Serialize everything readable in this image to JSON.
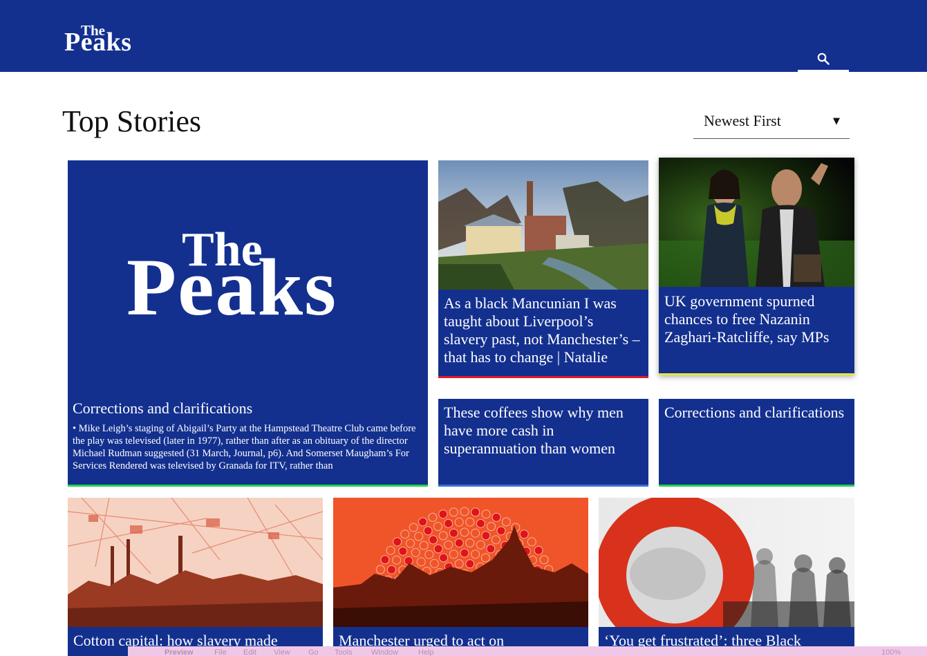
{
  "header": {
    "logo_the": "The",
    "logo_peaks": "Peaks",
    "search_icon": "search-icon",
    "brand_color": "#13308f"
  },
  "main": {
    "title": "Top Stories",
    "sort_label": "Newest First",
    "sort_caret": "▼"
  },
  "cards": {
    "lead": {
      "logo_the": "The",
      "logo_peaks": "Peaks",
      "headline": "Corrections and clarifications",
      "excerpt": "• Mike Leigh’s staging of Abigail’s Party at the Hampstead Theatre Club came before the play was televised (later in 1977), rather than after as an obituary of the director Michael Rudman suggested (31 March, Journal, p6). And Somerset Maugham’s For Services Rendered was televised by Granada for ITV, rather than",
      "accent": "#20d24a"
    },
    "c2": {
      "headline": "As a black Mancunian I was taught about Liverpool’s slavery past, not Manchester’s – that has to change | Natalie",
      "accent": "#e01b2a"
    },
    "c3": {
      "headline": "UK government spurned chances to free Nazanin Zaghari-Ratcliffe, say MPs",
      "accent": "#e9e83a"
    },
    "c4": {
      "headline": "These coffees show why men have more cash in superannuation than women",
      "accent": "#3a6fd6"
    },
    "c5": {
      "headline": "Corrections and clarifications",
      "accent": "#20d24a"
    },
    "c6": {
      "headline": "Cotton capital: how slavery made"
    },
    "c7": {
      "headline": "Manchester urged to act on"
    },
    "c8": {
      "headline": "‘You get frustrated’: three Black"
    }
  },
  "menubar": {
    "apple": "",
    "app": "Preview",
    "file": "File",
    "edit": "Edit",
    "view": "View",
    "go": "Go",
    "tools": "Tools",
    "window": "Window",
    "help": "Help",
    "zoom": "100%"
  }
}
